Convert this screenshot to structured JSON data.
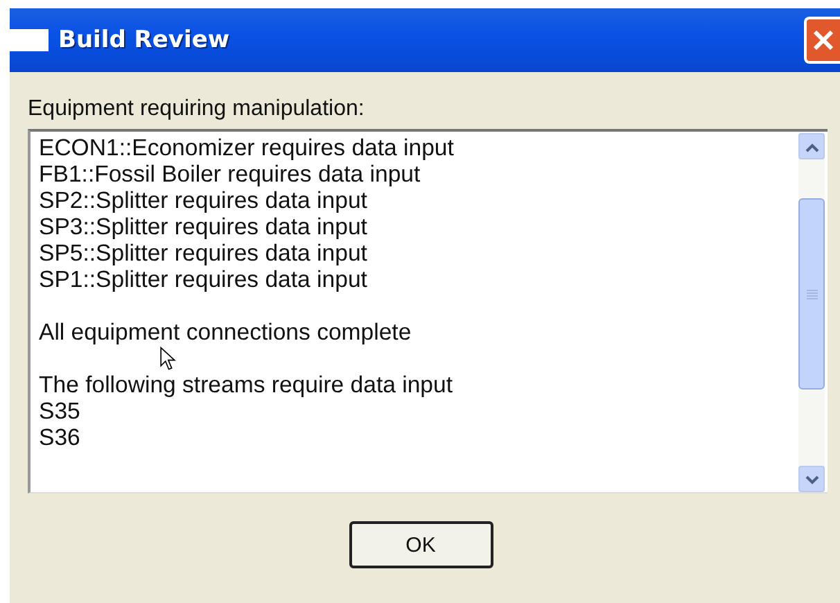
{
  "window": {
    "title": "Build Review"
  },
  "label": "Equipment requiring manipulation:",
  "lines": [
    {
      "kind": "text",
      "text": "ECON1::Economizer requires data input"
    },
    {
      "kind": "text",
      "text": "FB1::Fossil Boiler requires data input"
    },
    {
      "kind": "text",
      "text": "SP2::Splitter requires data input"
    },
    {
      "kind": "text",
      "text": "SP3::Splitter requires data input"
    },
    {
      "kind": "text",
      "text": "SP5::Splitter requires data input"
    },
    {
      "kind": "text",
      "text": "SP1::Splitter requires data input"
    },
    {
      "kind": "blank"
    },
    {
      "kind": "text",
      "text": "All equipment connections complete"
    },
    {
      "kind": "blank"
    },
    {
      "kind": "text",
      "text": "The following streams require data input"
    },
    {
      "kind": "text",
      "text": "S35"
    },
    {
      "kind": "text",
      "text": "S36"
    }
  ],
  "buttons": [
    "OK"
  ]
}
